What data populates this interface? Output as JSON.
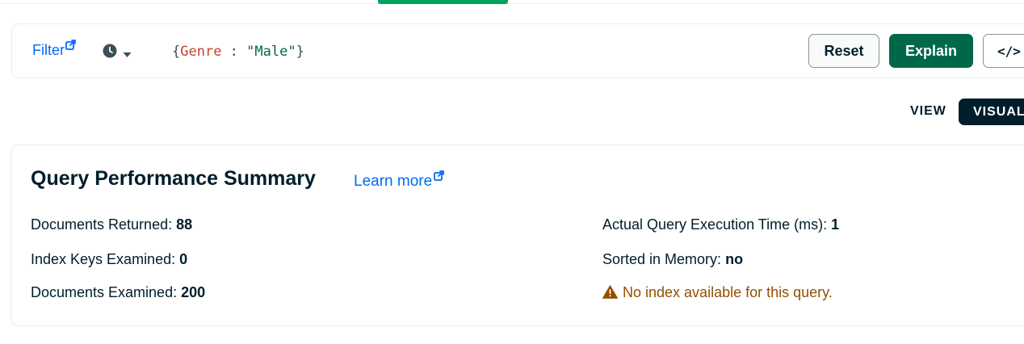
{
  "query_bar": {
    "filter_label": "Filter",
    "query": {
      "open_brace": "{",
      "key": "Genre",
      "separator": " : ",
      "value": "\"Male\"",
      "close_brace": "}"
    },
    "reset_label": "Reset",
    "explain_label": "Explain",
    "code_label": "</>"
  },
  "view_toggle": {
    "label": "VIEW",
    "selected": "VISUAL"
  },
  "summary": {
    "title": "Query Performance Summary",
    "learn_more": "Learn more",
    "docs_returned_label": "Documents Returned:",
    "docs_returned_value": "88",
    "keys_examined_label": "Index Keys Examined:",
    "keys_examined_value": "0",
    "docs_examined_label": "Documents Examined:",
    "docs_examined_value": "200",
    "exec_time_label": "Actual Query Execution Time (ms):",
    "exec_time_value": "1",
    "sorted_label": "Sorted in Memory:",
    "sorted_value": "no",
    "warning": "No index available for this query."
  },
  "colors": {
    "link": "#016bf8",
    "primary_green": "#00684a",
    "active_tab": "#00a35c",
    "warning": "#944f01",
    "dark": "#001e2b"
  },
  "icons": {
    "filter_ext": "external-link-icon",
    "history": "clock-icon",
    "history_caret": "caret-down-icon",
    "learn_more_ext": "external-link-icon",
    "warning": "warning-icon"
  }
}
